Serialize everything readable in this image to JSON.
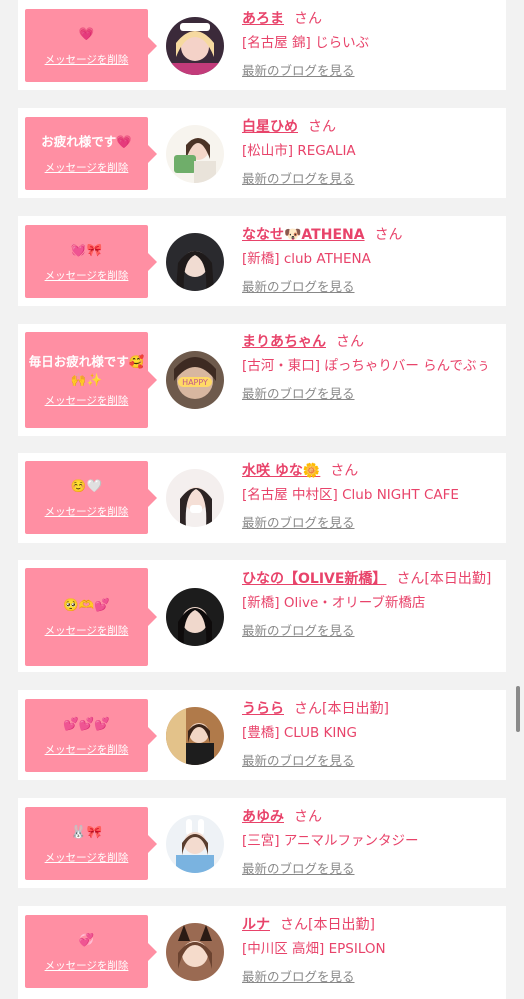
{
  "delete_label": "メッセージを削除",
  "blog_label": "最新のブログを見る",
  "colors": {
    "accent": "#e8436a",
    "message_box": "#ff8fa3",
    "background": "#f2f2f2"
  },
  "items": [
    {
      "message": "💗",
      "name": "あろま",
      "suffix": "さん",
      "shop": "[名古屋 錦] じらいぶ",
      "avatar": "avatar-photo-1"
    },
    {
      "message": "お疲れ様です💗",
      "name": "白星ひめ",
      "suffix": "さん",
      "shop": "[松山市] REGALIA",
      "avatar": "avatar-photo-2"
    },
    {
      "message": "💓🎀",
      "name": "ななせ🐶ATHENA",
      "suffix": "さん",
      "shop": "[新橋] club ATHENA",
      "avatar": "avatar-photo-3"
    },
    {
      "message": "毎日お疲れ様です🥰🙌✨",
      "name": "まりあちゃん",
      "suffix": "さん",
      "shop": "[古河・東口] ぽっちゃりバー らんでぶぅ",
      "avatar": "avatar-photo-4"
    },
    {
      "message": "☺️🤍",
      "name": "水咲 ゆな🌼",
      "suffix": "さん",
      "shop": "[名古屋 中村区] Club NIGHT CAFE",
      "avatar": "avatar-photo-5"
    },
    {
      "message": "🥺🫶💕",
      "name": "ひなの【OLIVE新橋】",
      "suffix": "さん[本日出勤]",
      "shop": "[新橋] Olive・オリーブ新橋店",
      "avatar": "avatar-photo-6"
    },
    {
      "message": "💕💕💕",
      "name": "うらら",
      "suffix": "さん[本日出勤]",
      "shop": "[豊橋] CLUB KING",
      "avatar": "avatar-photo-7"
    },
    {
      "message": "🐰🎀",
      "name": "あゆみ",
      "suffix": "さん",
      "shop": "[三宮] アニマルファンタジー",
      "avatar": "avatar-photo-8"
    },
    {
      "message": "💞",
      "name": "ルナ",
      "suffix": "さん[本日出勤]",
      "shop": "[中川区 高畑] EPSILON",
      "avatar": "avatar-photo-9"
    }
  ]
}
